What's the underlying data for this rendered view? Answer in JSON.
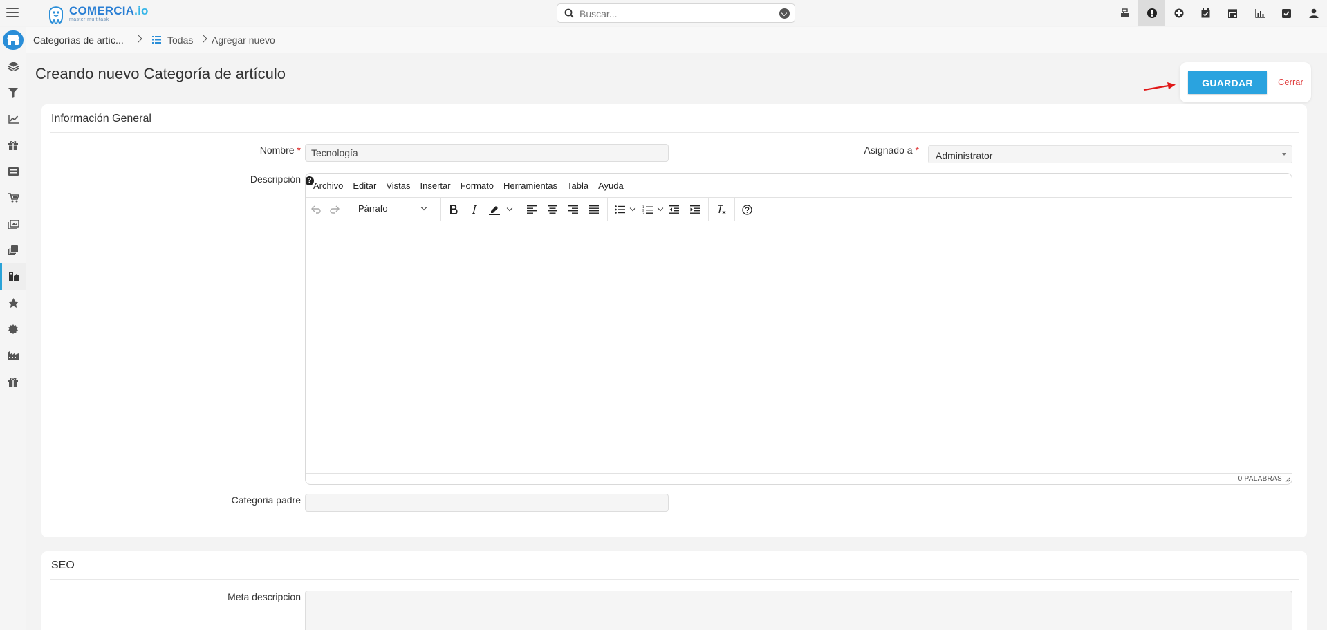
{
  "app": {
    "logo_title_a": "COMERCIA",
    "logo_title_b": ".io",
    "logo_subtitle": "master multitask"
  },
  "search": {
    "placeholder": "Buscar..."
  },
  "top_icons": [
    "cash-register-icon",
    "alert-icon",
    "plus-circle-icon",
    "calendar-check-icon",
    "calendar-icon",
    "bar-chart-icon",
    "checkbox-icon",
    "user-icon"
  ],
  "breadcrumb": {
    "module": "Categorías de artíc...",
    "list": "Todas",
    "current": "Agregar nuevo"
  },
  "sidebar": {
    "items": [
      "layers-icon",
      "filter-icon",
      "line-chart-icon",
      "gift-icon",
      "list-icon",
      "cart-icon",
      "images-icon",
      "copy-icon",
      "categories-icon",
      "star-icon",
      "gear-badge-icon",
      "factory-icon",
      "gift-alt-icon"
    ],
    "active_index": 8
  },
  "page": {
    "title": "Creando nuevo Categoría de artículo"
  },
  "actions": {
    "save_label": "GUARDAR",
    "close_label": "Cerrar"
  },
  "general": {
    "title": "Información General",
    "name_label": "Nombre",
    "name_value": "Tecnología",
    "assigned_label": "Asignado a",
    "assigned_value": "Administrator",
    "description_label": "Descripción",
    "parent_label": "Categoria padre",
    "parent_value": ""
  },
  "editor": {
    "menu": [
      "Archivo",
      "Editar",
      "Vistas",
      "Insertar",
      "Formato",
      "Herramientas",
      "Tabla",
      "Ayuda"
    ],
    "block_format": "Párrafo",
    "word_count": "0 PALABRAS"
  },
  "seo": {
    "title": "SEO",
    "meta_label": "Meta descripcion"
  },
  "colors": {
    "accent": "#2aa3df",
    "danger": "#e04040"
  }
}
